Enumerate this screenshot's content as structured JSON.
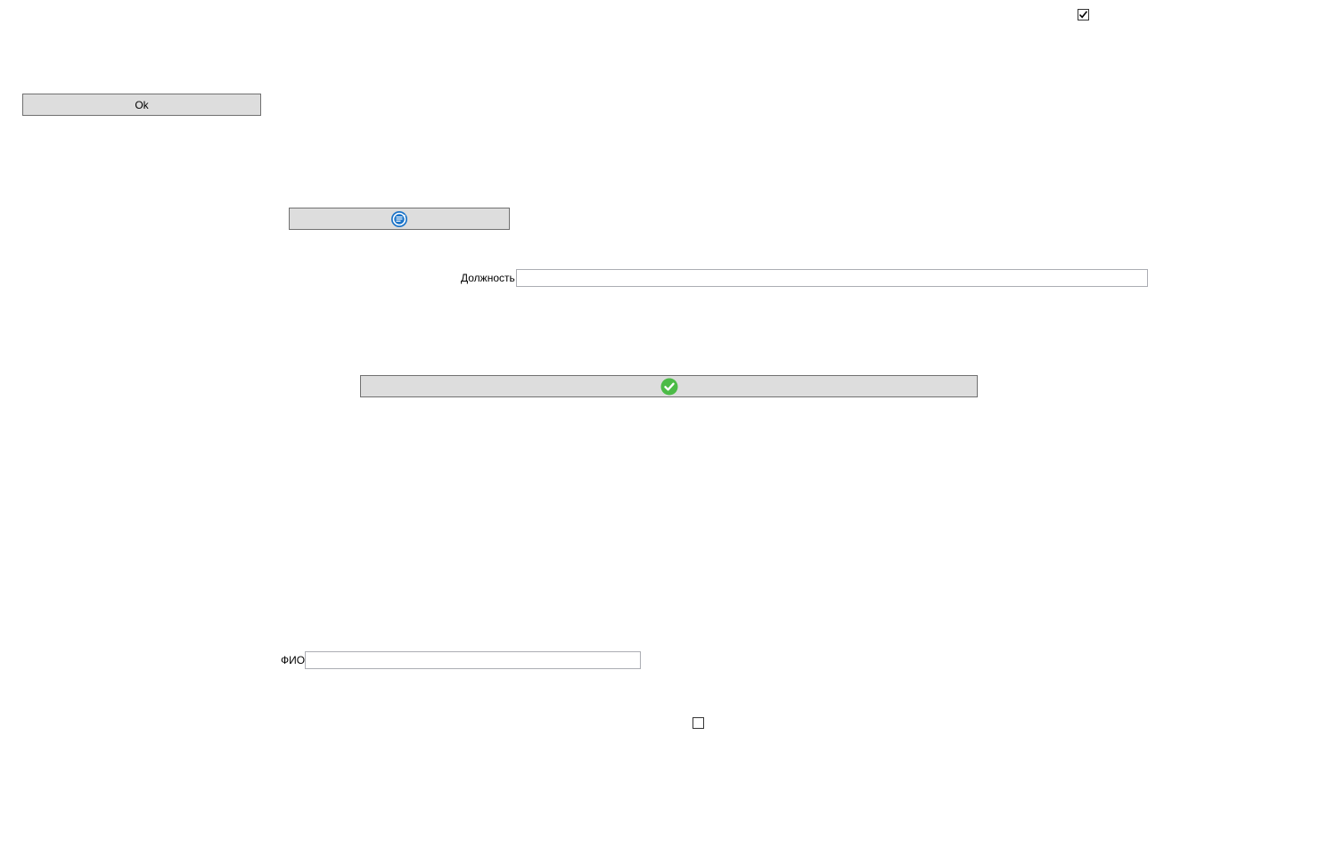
{
  "top_checkbox": {
    "checked": true,
    "icon": "checkmark-icon"
  },
  "ok_button": {
    "label": "Ok"
  },
  "refresh_button": {
    "icon": "sync-icon",
    "icon_color": "#1a73c8"
  },
  "position_field": {
    "label": "Должность",
    "value": ""
  },
  "confirm_button": {
    "icon": "green-check-icon",
    "icon_color": "#4cbb47"
  },
  "fio_field": {
    "label": "ФИО",
    "value": ""
  },
  "bottom_checkbox": {
    "checked": false
  }
}
